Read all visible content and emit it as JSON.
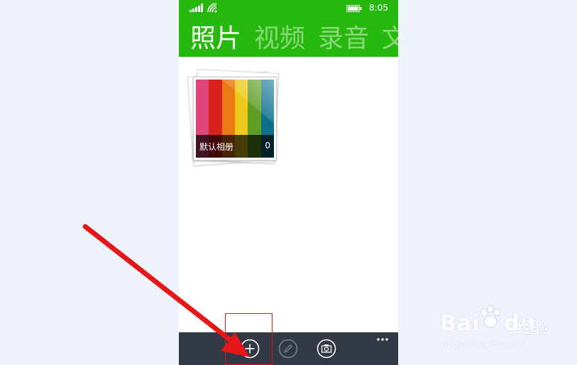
{
  "status_bar": {
    "time": "8:05",
    "icons": [
      "signal-icon",
      "wifi-icon",
      "battery-icon"
    ]
  },
  "header": {
    "background_color": "#27b80e",
    "tabs": [
      {
        "label": "照片",
        "active": true
      },
      {
        "label": "视频",
        "active": false
      },
      {
        "label": "录音",
        "active": false
      },
      {
        "label": "文",
        "active": false
      }
    ]
  },
  "albums": [
    {
      "name": "默认相册",
      "count": "0",
      "stripe_colors": [
        "#e0457b",
        "#d8211c",
        "#ea7b12",
        "#ecc91a",
        "#5e9e26",
        "#0c6f8c"
      ]
    }
  ],
  "app_bar": {
    "background_color": "#323844",
    "buttons": [
      {
        "icon": "plus-circle-icon",
        "enabled": true
      },
      {
        "icon": "pencil-circle-icon",
        "enabled": false
      },
      {
        "icon": "camera-circle-icon",
        "enabled": true
      }
    ],
    "more_icon": "ellipsis-icon"
  },
  "annotation": {
    "highlight_color": "#e41818",
    "arrow_color": "#e41818"
  },
  "watermark": {
    "logo_text": "Bai",
    "logo_text_suffix": "du",
    "name": "经验",
    "url": "jingyan.baidu.com"
  }
}
